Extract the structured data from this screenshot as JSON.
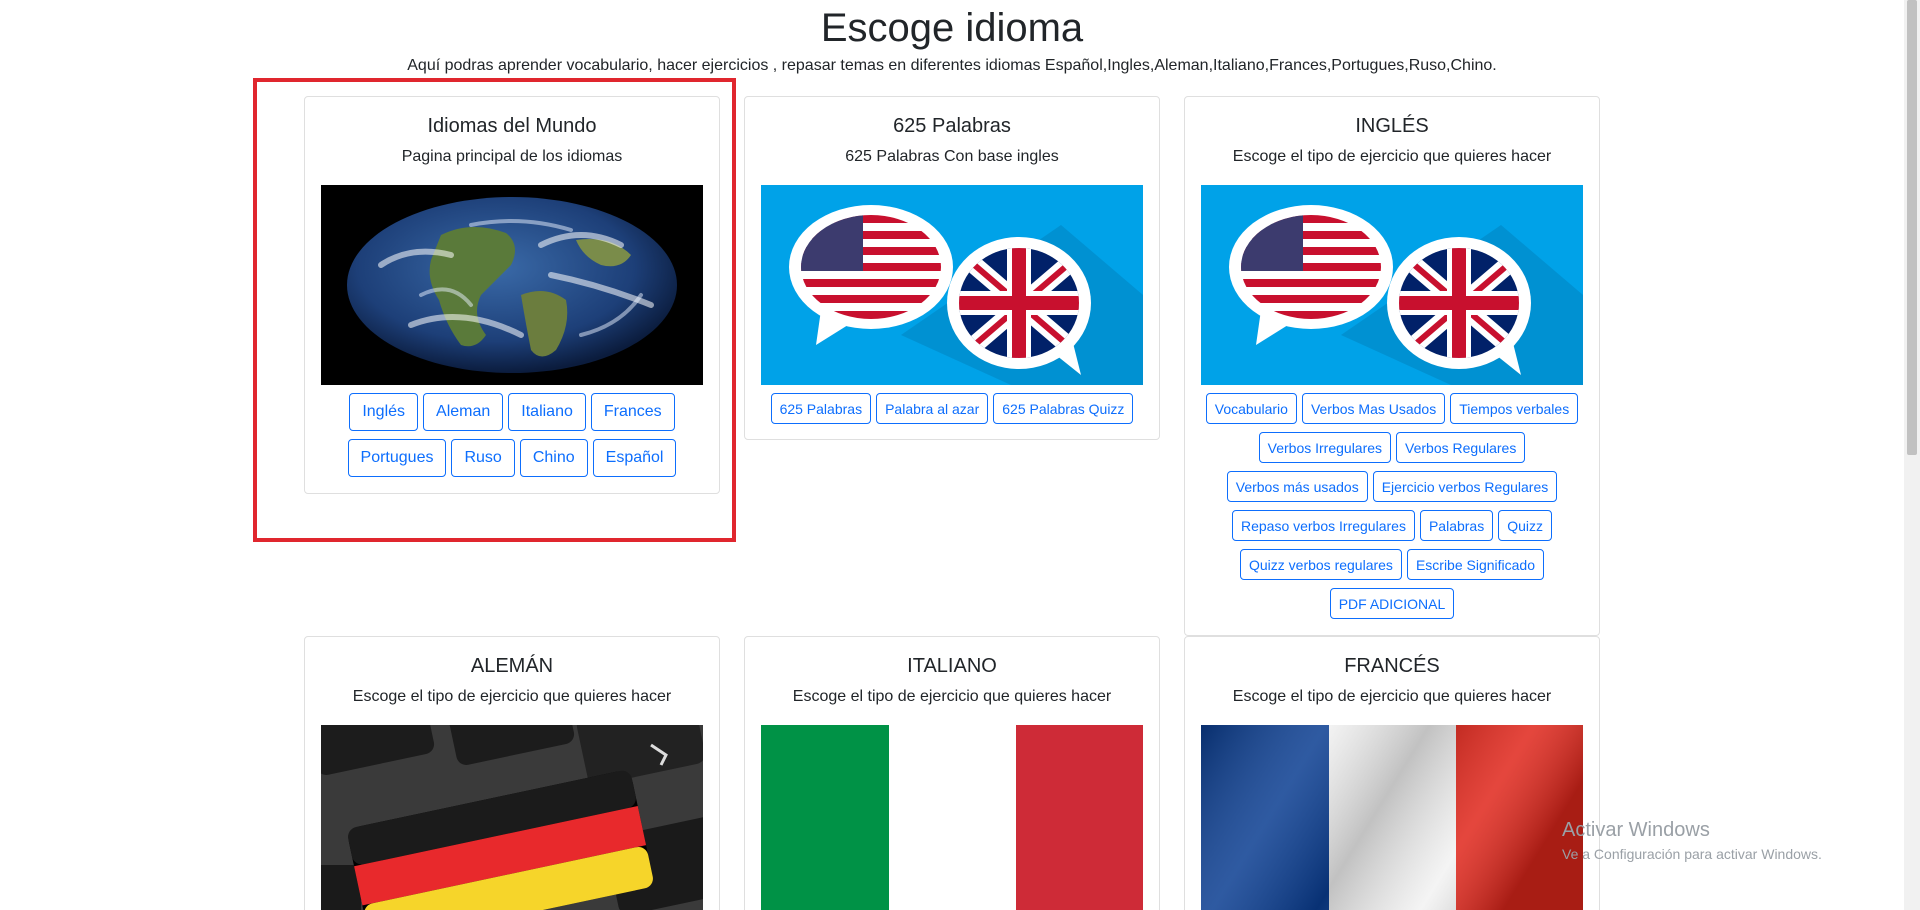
{
  "page": {
    "title": "Escoge idioma",
    "subtitle": "Aquí podras aprender vocabulario, hacer ejercicios , repasar temas en diferentes idiomas Español,Ingles,Aleman,Italiano,Frances,Portugues,Ruso,Chino."
  },
  "cards": {
    "mundo": {
      "title": "Idiomas del Mundo",
      "desc": "Pagina principal de los idiomas",
      "buttons": [
        "Inglés",
        "Aleman",
        "Italiano",
        "Frances",
        "Portugues",
        "Ruso",
        "Chino",
        "Español"
      ]
    },
    "palabras625": {
      "title": "625 Palabras",
      "desc": "625 Palabras Con base ingles",
      "buttons": [
        "625 Palabras",
        "Palabra al azar",
        "625 Palabras Quizz"
      ]
    },
    "ingles": {
      "title": "INGLÉS",
      "desc": "Escoge el tipo de ejercicio que quieres hacer",
      "buttons": [
        "Vocabulario",
        "Verbos Mas Usados",
        "Tiempos verbales",
        "Verbos Irregulares",
        "Verbos Regulares",
        "Verbos más usados",
        "Ejercicio verbos Regulares",
        "Repaso verbos Irregulares",
        "Palabras",
        "Quizz",
        "Quizz verbos regulares",
        "Escribe Significado",
        "PDF ADICIONAL"
      ]
    },
    "aleman": {
      "title": "ALEMÁN",
      "desc": "Escoge el tipo de ejercicio que quieres hacer"
    },
    "italiano": {
      "title": "ITALIANO",
      "desc": "Escoge el tipo de ejercicio que quieres hacer"
    },
    "frances": {
      "title": "FRANCÉS",
      "desc": "Escoge el tipo de ejercicio que quieres hacer"
    }
  },
  "watermark": {
    "title": "Activar Windows",
    "subtitle": "Ve a Configuración para activar Windows."
  },
  "colors": {
    "accent": "#0d6efd",
    "highlight": "#e0262e",
    "sky_blue": "#00a2e8",
    "us_red": "#c8102e",
    "uk_blue": "#012169",
    "it_green": "#009246",
    "it_red": "#ce2b37",
    "fr_blue": "#0a3d91"
  }
}
